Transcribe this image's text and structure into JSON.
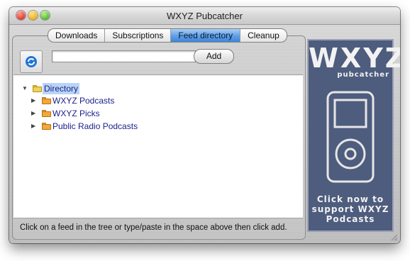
{
  "window": {
    "title": "WXYZ Pubcatcher"
  },
  "tabs": [
    {
      "label": "Downloads",
      "active": false
    },
    {
      "label": "Subscriptions",
      "active": false
    },
    {
      "label": "Feed directory",
      "active": true
    },
    {
      "label": "Cleanup",
      "active": false
    }
  ],
  "toolbar": {
    "refresh_icon": "refresh-icon",
    "url_input_value": "",
    "add_label": "Add"
  },
  "tree": {
    "root": {
      "label": "Directory",
      "expanded": true,
      "selected": true
    },
    "children": [
      {
        "label": "WXYZ Podcasts",
        "expanded": false
      },
      {
        "label": "WXYZ Picks",
        "expanded": false
      },
      {
        "label": "Public Radio Podcasts",
        "expanded": false
      }
    ]
  },
  "status": {
    "text": "Click on a feed in the tree or type/paste in the space above then click add."
  },
  "ad": {
    "brand": "WXYZ",
    "sub": "pubcatcher",
    "cta_line1": "Click now to",
    "cta_line2": "support WXYZ",
    "cta_line3": "Podcasts",
    "bg_color": "#4e5c7e",
    "text_color": "#f2f2f2"
  },
  "colors": {
    "tab_active": "#5e9ee6",
    "tree_text": "#1a1f88",
    "selection": "#b9d4f5"
  }
}
